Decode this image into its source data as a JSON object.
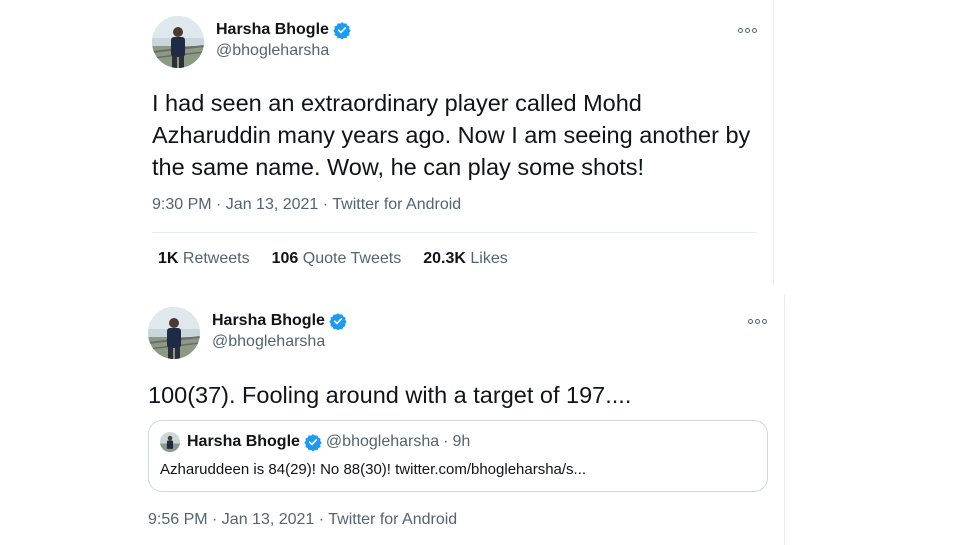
{
  "tweet1": {
    "name": "Harsha Bhogle",
    "handle": "@bhogleharsha",
    "text": "I had seen an extraordinary player called Mohd Azharuddin many years ago. Now I am seeing another by the same name. Wow, he can play some shots!",
    "meta": "9:30 PM · Jan 13, 2021 · Twitter for Android",
    "stats": {
      "retweets_count": "1K",
      "retweets_label": "Retweets",
      "quotes_count": "106",
      "quotes_label": "Quote Tweets",
      "likes_count": "20.3K",
      "likes_label": "Likes"
    }
  },
  "tweet2": {
    "name": "Harsha Bhogle",
    "handle": "@bhogleharsha",
    "text": "100(37). Fooling around with a target of 197....",
    "meta": "9:56 PM · Jan 13, 2021 · Twitter for Android",
    "quote": {
      "name": "Harsha Bhogle",
      "handle": "@bhogleharsha",
      "separator": "·",
      "time": "9h",
      "text": "Azharuddeen is 84(29)! No 88(30)! twitter.com/bhogleharsha/s..."
    }
  },
  "icons": {
    "verified": "verified-badge-icon",
    "more": "more-options-icon",
    "avatar": "profile-photo"
  },
  "colors": {
    "verified_blue": "#1d9bf0",
    "secondary_text": "#536471",
    "border": "#cfd9de"
  }
}
